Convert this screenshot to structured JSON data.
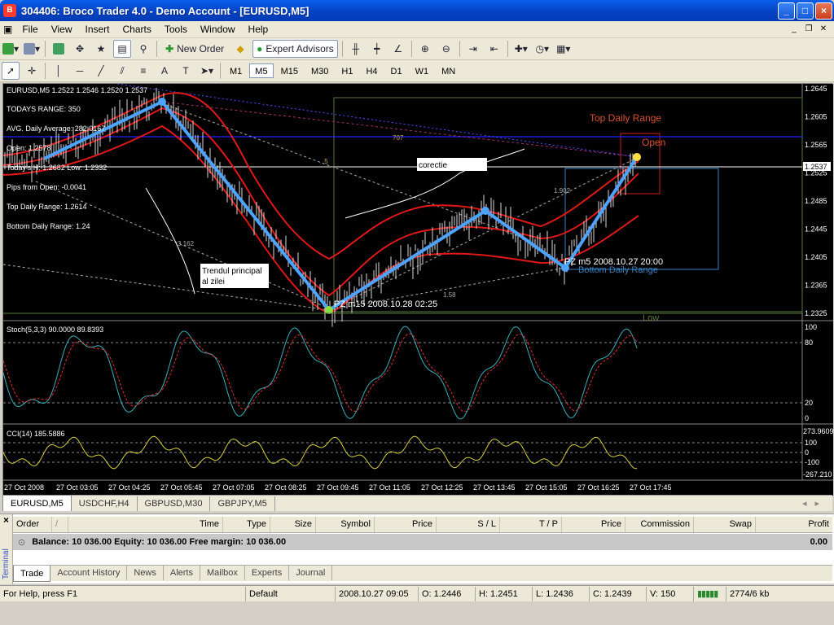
{
  "window": {
    "title": "304406: Broco Trader 4.0 - Demo Account - [EURUSD,M5]",
    "min": "_",
    "max": "□",
    "close": "×"
  },
  "menu": [
    "File",
    "View",
    "Insert",
    "Charts",
    "Tools",
    "Window",
    "Help"
  ],
  "toolbar": {
    "new_order": "New Order",
    "expert_advisors": "Expert Advisors"
  },
  "timeframes": [
    "M1",
    "M5",
    "M15",
    "M30",
    "H1",
    "H4",
    "D1",
    "W1",
    "MN"
  ],
  "active_timeframe": "M5",
  "chart": {
    "symbol_line": "EURUSD,M5  1.2522  1.2546  1.2520  1.2537",
    "info": [
      "TODAYS RANGE: 350",
      "AVG. Daily Average: 282.0167",
      "Open: 1.2578",
      "Today's H: 1.2682  Low: 1.2332",
      "Pips from Open: -0.0041",
      "Top Daily Range: 1.2614",
      "Bottom Daily Range: 1.24"
    ],
    "price_axis": [
      "1.2645",
      "1.2605",
      "1.2565",
      "1.2525",
      "1.2485",
      "1.2445",
      "1.2405",
      "1.2365",
      "1.2325"
    ],
    "current_price": "1.2537",
    "labels": {
      "top_daily_range": "Top Daily Range",
      "open": "Open",
      "low": "Low",
      "bottom_daily_range": "Bottom Daily Range",
      "pz_m15": "PZ m15   2008.10.28 02:25",
      "pz_m5": "PZ m5   2008.10.27 20:00",
      "corectie": "corectie",
      "trend_line1": "Trendul principal",
      "trend_line2": "al zilei",
      "fib_707": "707",
      "fib_5": ".5",
      "fib_3": "3.162",
      "fib_902": "1.902",
      "fib_158": "1.58"
    },
    "stoch_title": "Stoch(5,3,3) 90.0000 89.8393",
    "stoch_axis": [
      "100",
      "80",
      "20",
      "0"
    ],
    "cci_title": "CCI(14) 185.5886",
    "cci_axis": [
      "273.9609",
      "100",
      "0",
      "-100",
      "-267.210"
    ],
    "time_axis": [
      "27 Oct 2008",
      "27 Oct 03:05",
      "27 Oct 04:25",
      "27 Oct 05:45",
      "27 Oct 07:05",
      "27 Oct 08:25",
      "27 Oct 09:45",
      "27 Oct 11:05",
      "27 Oct 12:25",
      "27 Oct 13:45",
      "27 Oct 15:05",
      "27 Oct 16:25",
      "27 Oct 17:45"
    ]
  },
  "chart_tabs": [
    "EURUSD,M5",
    "USDCHF,H4",
    "GBPUSD,M30",
    "GBPJPY,M5"
  ],
  "terminal": {
    "side_label": "Terminal",
    "columns": [
      "Order",
      "/",
      "Time",
      "Type",
      "Size",
      "Symbol",
      "Price",
      "S / L",
      "T / P",
      "Price",
      "Commission",
      "Swap",
      "Profit"
    ],
    "balance": "Balance: 10 036.00  Equity: 10 036.00  Free margin: 10 036.00",
    "profit": "0.00",
    "tabs": [
      "Trade",
      "Account History",
      "News",
      "Alerts",
      "Mailbox",
      "Experts",
      "Journal"
    ]
  },
  "status": {
    "help": "For Help, press F1",
    "profile": "Default",
    "time": "2008.10.27 09:05",
    "open": "O: 1.2446",
    "high": "H: 1.2451",
    "low": "L: 1.2436",
    "close": "C: 1.2439",
    "volume": "V: 150",
    "traffic": "2774/6 kb"
  }
}
